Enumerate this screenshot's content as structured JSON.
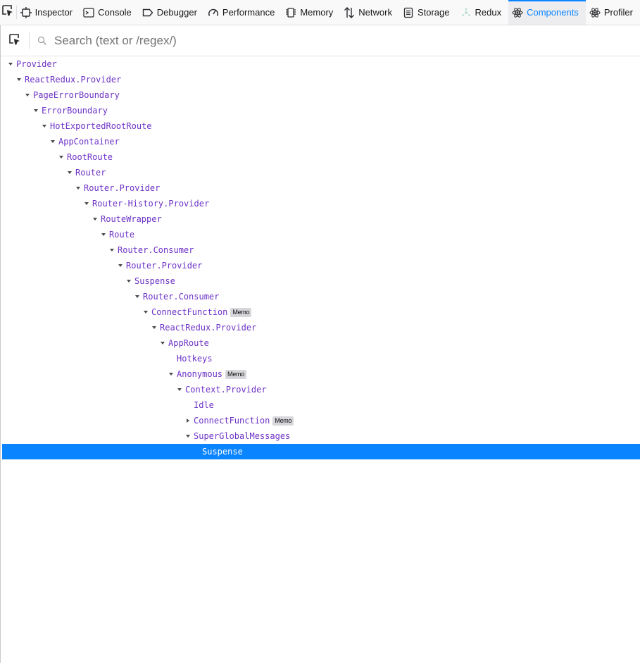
{
  "toolbar": {
    "tabs": [
      {
        "label": "Inspector",
        "icon": "inspector-icon"
      },
      {
        "label": "Console",
        "icon": "console-icon"
      },
      {
        "label": "Debugger",
        "icon": "debugger-icon"
      },
      {
        "label": "Performance",
        "icon": "performance-icon"
      },
      {
        "label": "Memory",
        "icon": "memory-icon"
      },
      {
        "label": "Network",
        "icon": "network-icon"
      },
      {
        "label": "Storage",
        "icon": "storage-icon"
      },
      {
        "label": "Redux",
        "icon": "redux-icon"
      },
      {
        "label": "Components",
        "icon": "react-icon"
      },
      {
        "label": "Profiler",
        "icon": "react-icon"
      }
    ],
    "selected_tab": "Components",
    "accent_color": "#0a84ff"
  },
  "search": {
    "placeholder": "Search (text or /regex/)",
    "value": ""
  },
  "tree": {
    "name_color": "#6d33c7",
    "selected_bg": "#0a84ff",
    "nodes": [
      {
        "name": "Provider",
        "depth": 0,
        "state": "expanded"
      },
      {
        "name": "ReactRedux.Provider",
        "depth": 1,
        "state": "expanded"
      },
      {
        "name": "PageErrorBoundary",
        "depth": 2,
        "state": "expanded"
      },
      {
        "name": "ErrorBoundary",
        "depth": 3,
        "state": "expanded"
      },
      {
        "name": "HotExportedRootRoute",
        "depth": 4,
        "state": "expanded"
      },
      {
        "name": "AppContainer",
        "depth": 5,
        "state": "expanded"
      },
      {
        "name": "RootRoute",
        "depth": 6,
        "state": "expanded"
      },
      {
        "name": "Router",
        "depth": 7,
        "state": "expanded"
      },
      {
        "name": "Router.Provider",
        "depth": 8,
        "state": "expanded"
      },
      {
        "name": "Router-History.Provider",
        "depth": 9,
        "state": "expanded"
      },
      {
        "name": "RouteWrapper",
        "depth": 10,
        "state": "expanded"
      },
      {
        "name": "Route",
        "depth": 11,
        "state": "expanded"
      },
      {
        "name": "Router.Consumer",
        "depth": 12,
        "state": "expanded"
      },
      {
        "name": "Router.Provider",
        "depth": 13,
        "state": "expanded"
      },
      {
        "name": "Suspense",
        "depth": 14,
        "state": "expanded"
      },
      {
        "name": "Router.Consumer",
        "depth": 15,
        "state": "expanded"
      },
      {
        "name": "ConnectFunction",
        "depth": 16,
        "state": "expanded",
        "badge": "Memo"
      },
      {
        "name": "ReactRedux.Provider",
        "depth": 17,
        "state": "expanded"
      },
      {
        "name": "AppRoute",
        "depth": 18,
        "state": "expanded"
      },
      {
        "name": "Hotkeys",
        "depth": 19,
        "state": "leaf"
      },
      {
        "name": "Anonymous",
        "depth": 19,
        "state": "expanded",
        "badge": "Memo"
      },
      {
        "name": "Context.Provider",
        "depth": 20,
        "state": "expanded"
      },
      {
        "name": "Idle",
        "depth": 21,
        "state": "leaf"
      },
      {
        "name": "ConnectFunction",
        "depth": 21,
        "state": "collapsed",
        "badge": "Memo"
      },
      {
        "name": "SuperGlobalMessages",
        "depth": 21,
        "state": "expanded"
      },
      {
        "name": "Suspense",
        "depth": 22,
        "state": "leaf",
        "selected": true
      }
    ]
  }
}
